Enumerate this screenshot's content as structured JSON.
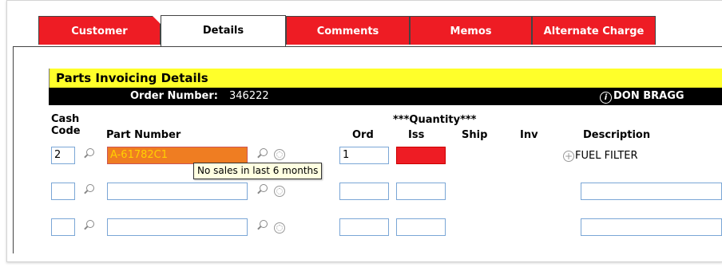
{
  "tabs": [
    {
      "label": "Customer",
      "active": false
    },
    {
      "label": "Details",
      "active": true
    },
    {
      "label": "Comments",
      "active": false
    },
    {
      "label": "Memos",
      "active": false
    },
    {
      "label": "Alternate Charge",
      "active": false
    }
  ],
  "panel": {
    "title": "Parts Invoicing Details",
    "order_label": "Order Number:",
    "order_number": "346222",
    "user_name": "DON BRAGG"
  },
  "headers": {
    "cash_line1": "Cash",
    "cash_line2": "Code",
    "part_number": "Part Number",
    "quantity": "***Quantity***",
    "ord": "Ord",
    "iss": "Iss",
    "ship": "Ship",
    "inv": "Inv",
    "description": "Description"
  },
  "rows": [
    {
      "cash_code": "2",
      "part_number": "A-61782C1",
      "ord": "1",
      "iss": "",
      "description": "FUEL FILTER"
    },
    {
      "cash_code": "",
      "part_number": "",
      "ord": "",
      "iss": "",
      "description": ""
    },
    {
      "cash_code": "",
      "part_number": "",
      "ord": "",
      "iss": "",
      "description": ""
    }
  ],
  "tooltip": "No sales in last 6 months",
  "colors": {
    "tab_red": "#ee1c24",
    "title_yellow": "#ffff2a",
    "active_part_orange": "#ef7d22",
    "iss_error_red": "#ee1c24",
    "field_border": "#7aa6d6"
  },
  "icons": {
    "lookup": "magnifier-icon",
    "price": "coin-icon",
    "info": "info-icon",
    "expand": "plus-circle-icon"
  }
}
